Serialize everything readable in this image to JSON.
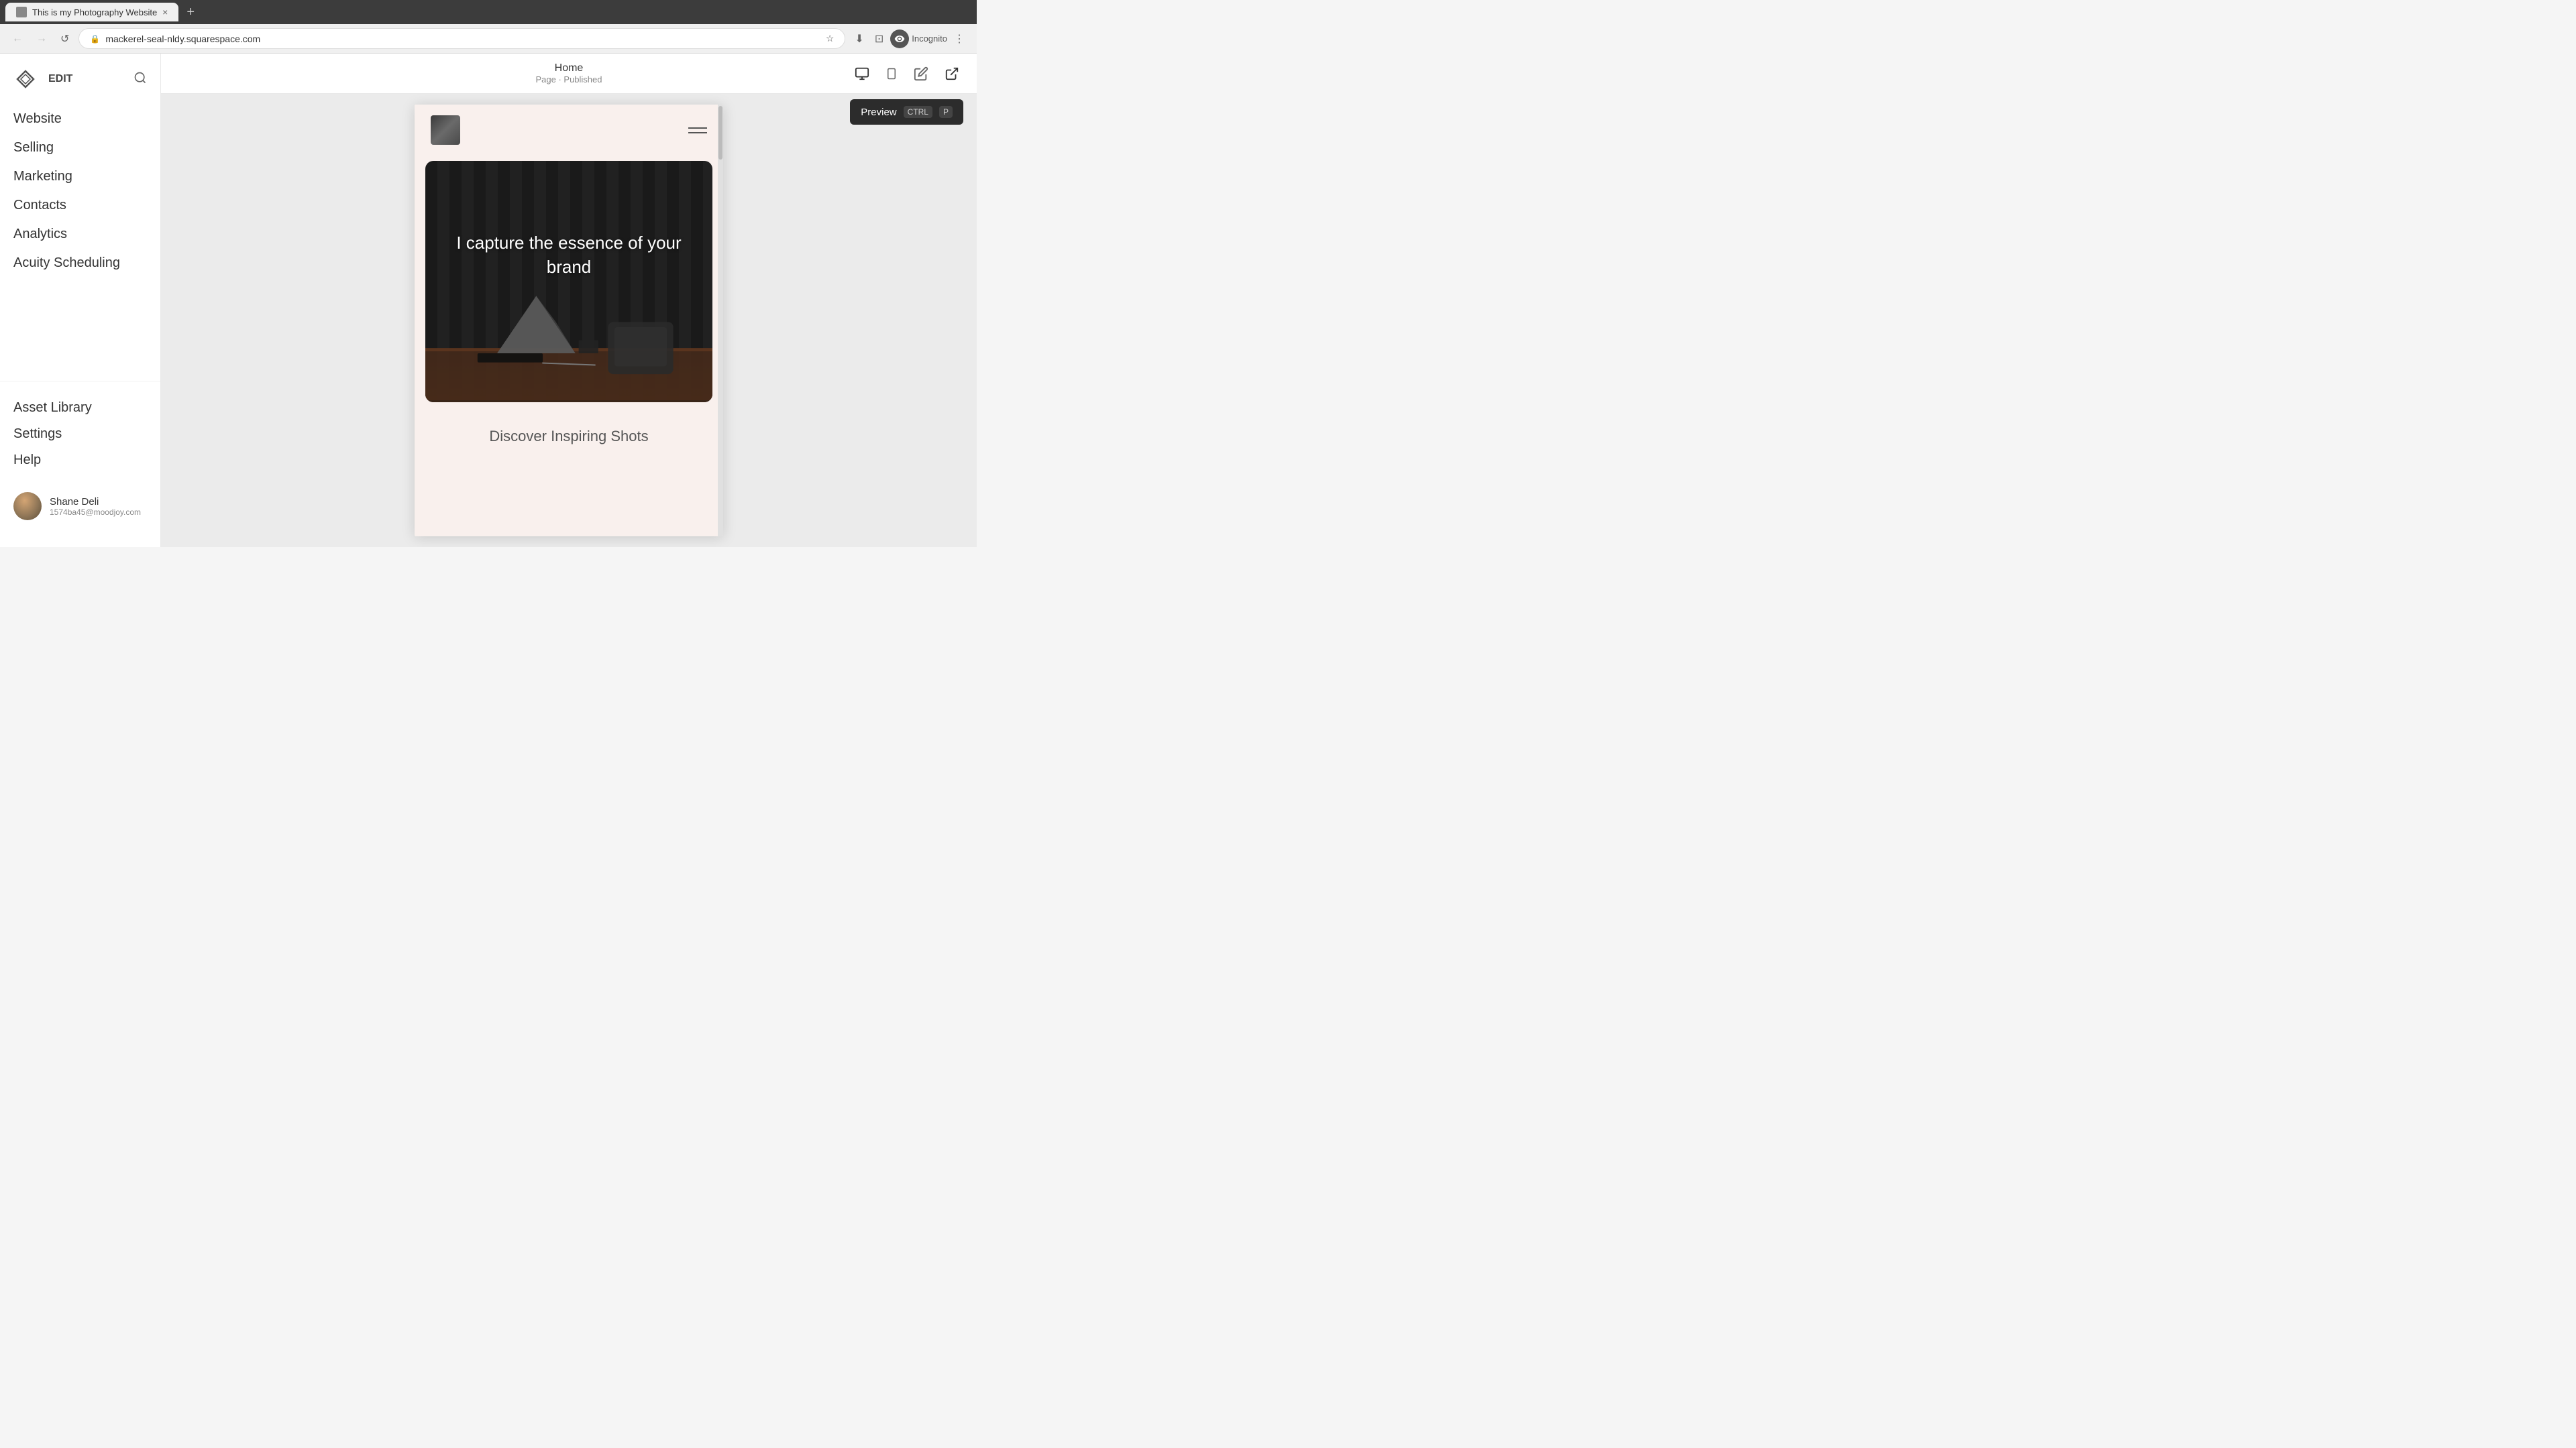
{
  "browser": {
    "tab_title": "This is my Photography Website",
    "tab_favicon": "🌐",
    "close_label": "×",
    "new_tab_label": "+",
    "back_label": "←",
    "forward_label": "→",
    "refresh_label": "↺",
    "address": "mackerel-seal-nldy.squarespace.com",
    "bookmark_label": "☆",
    "download_label": "⬇",
    "extensions_label": "⊡",
    "incognito_label": "Incognito",
    "menu_label": "⋮"
  },
  "toolbar": {
    "edit_label": "EDIT",
    "page_title": "Home",
    "page_status": "Page · Published",
    "desktop_icon": "desktop",
    "mobile_icon": "mobile",
    "edit_icon": "pencil",
    "preview_icon": "arrow-diagonal",
    "preview_label": "Preview",
    "preview_shortcut_ctrl": "CTRL",
    "preview_shortcut_key": "P"
  },
  "sidebar": {
    "logo_label": "squarespace",
    "search_label": "search",
    "nav_items": [
      {
        "label": "Website",
        "id": "website"
      },
      {
        "label": "Selling",
        "id": "selling"
      },
      {
        "label": "Marketing",
        "id": "marketing"
      },
      {
        "label": "Contacts",
        "id": "contacts"
      },
      {
        "label": "Analytics",
        "id": "analytics"
      },
      {
        "label": "Acuity Scheduling",
        "id": "acuity"
      }
    ],
    "bottom_items": [
      {
        "label": "Asset Library",
        "id": "asset-library"
      },
      {
        "label": "Settings",
        "id": "settings"
      },
      {
        "label": "Help",
        "id": "help"
      }
    ],
    "user": {
      "name": "Shane Deli",
      "email": "1574ba45@moodjoy.com"
    }
  },
  "preview": {
    "hero_text": "I capture the essence of your brand",
    "discover_text": "Discover Inspiring Shots"
  }
}
